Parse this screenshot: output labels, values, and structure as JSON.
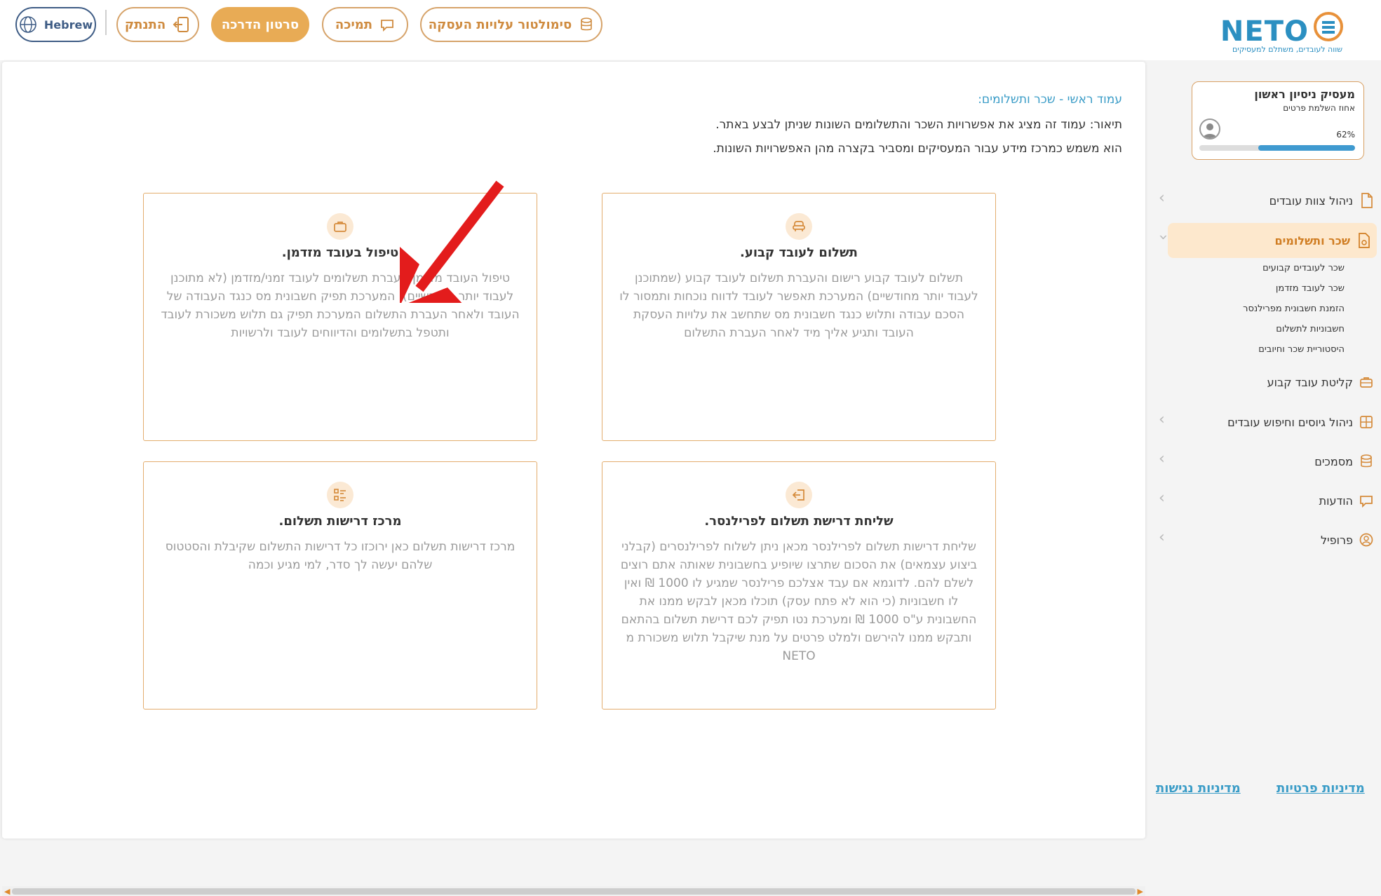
{
  "header": {
    "language_label": "Hebrew",
    "logout_label": "התנתק",
    "tutorial_label": "סרטון הדרכה",
    "support_label": "תמיכה",
    "simulator_label": "סימולטור עלויות העסקה",
    "logo_text": "NETO",
    "logo_tagline": "שווה לעובדים, משתלם למעסיקים"
  },
  "profile": {
    "name": "מעסיק ניסיון ראשון",
    "completion_label": "אחוז השלמת פרטים",
    "percent_text": "62%",
    "percent": 62
  },
  "sidebar": {
    "items": [
      {
        "label": "ניהול צוות עובדים",
        "icon": "document-icon"
      },
      {
        "label": "שכר ותשלומים",
        "icon": "payroll-document-icon",
        "active": true
      },
      {
        "label": "קליטת עובד קבוע",
        "icon": "briefcase-icon"
      },
      {
        "label": "ניהול גיוסים וחיפוש עובדים",
        "icon": "grid-plus-icon"
      },
      {
        "label": "מסמכים",
        "icon": "database-icon"
      },
      {
        "label": "הודעות",
        "icon": "chat-icon"
      },
      {
        "label": "פרופיל",
        "icon": "user-circle-icon"
      }
    ],
    "subitems": [
      "שכר לעובדים קבועים",
      "שכר לעובד מזדמן",
      "הזמנת חשבונית מפרילנסר",
      "חשבוניות לתשלום",
      "היסטוריית שכר וחיובים"
    ],
    "privacy_policy": "מדיניות פרטיות",
    "accessibility_policy": "מדיניות נגישות"
  },
  "main": {
    "breadcrumb": "עמוד ראשי - שכר ותשלומים:",
    "description_line1": "תיאור: עמוד זה מציג את אפשרויות השכר והתשלומים השונות שניתן לבצע באתר.",
    "description_line2": "הוא משמש כמרכז מידע עבור המעסיקים ומסביר בקצרה מהן האפשרויות השונות.",
    "cards": [
      {
        "title": "תשלום לעובד קבוע.",
        "body": "תשלום לעובד קבוע רישום והעברת תשלום לעובד קבוע (שמתוכנן לעבוד יותר מחודשיים) המערכת תאפשר לעובד לדווח נוכחות ותמסור לו הסכם עבודה ותלוש כנגד חשבונית מס שתחשב את עלויות העסקת העובד ותגיע אליך מיד לאחר העברת התשלום",
        "icon": "armchair-icon"
      },
      {
        "title": "טיפול בעובד מזדמן.",
        "body": "טיפול העובד מזדמן העברת תשלומים לעובד זמני/מזדמן (לא מתוכנן לעבוד יותר מחודשיים), המערכת תפיק חשבונית מס כנגד העבודה של העובד ולאחר העברת התשלום המערכת תפיק גם תלוש משכורת לעובד ותטפל בתשלומים והדיווחים לעובד ולרשויות",
        "icon": "briefcase-icon"
      },
      {
        "title": "שליחת דרישת תשלום לפרילנסר.",
        "body": "שליחת דרישות תשלום לפרילנסר מכאן ניתן לשלוח לפרילנסרים (קבלני ביצוע עצמאים) את הסכום שתרצו שיופיע בחשבונית שאותה אתם רוצים לשלם להם. לדוגמא אם עבד אצלכם פרילנסר שמגיע לו 1000 ₪ ואין לו חשבוניות (כי הוא לא פתח עסק) תוכלו מכאן לבקש ממנו את החשבונית ע\"ס 1000 ₪ ומערכת נטו תפיק לכם דרישת תשלום בהתאם ותבקש ממנו להירשם ולמלט פרטים על מנת שיקבל תלוש משכורת מ NETO",
        "icon": "login-box-icon"
      },
      {
        "title": "מרכז דרישות תשלום.",
        "body": "מרכז דרישות תשלום כאן ירוכזו כל דרישות התשלום שקיבלת והסטטוס שלהם יעשה לך סדר, למי מגיע וכמה",
        "icon": "checklist-icon"
      }
    ]
  },
  "colors": {
    "accent": "#e8ab55",
    "brand_blue": "#2b8fc1",
    "card_border": "#e3ad6e",
    "annotation_arrow": "#e31c1c"
  }
}
